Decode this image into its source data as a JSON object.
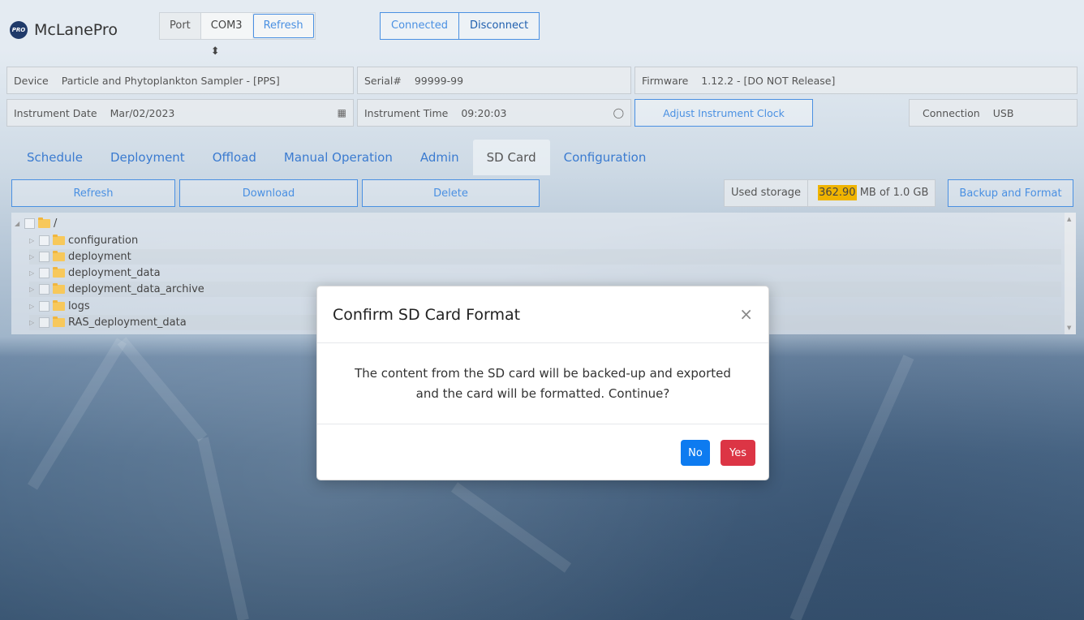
{
  "brand": {
    "logo": "PRO",
    "name": "McLanePro"
  },
  "port": {
    "label": "Port",
    "value": "COM3 ⬍",
    "refresh": "Refresh"
  },
  "connection_buttons": {
    "connected": "Connected",
    "disconnect": "Disconnect"
  },
  "device": {
    "device_label": "Device",
    "device_value": "Particle and Phytoplankton Sampler - [PPS]",
    "serial_label": "Serial#",
    "serial_value": "99999-99",
    "firmware_label": "Firmware",
    "firmware_value": "1.12.2 - [DO NOT Release]",
    "date_label": "Instrument Date",
    "date_value": "Mar/02/2023",
    "time_label": "Instrument Time",
    "time_value": "09:20:03",
    "adjust_clock": "Adjust Instrument Clock",
    "connection_label": "Connection",
    "connection_value": "USB"
  },
  "tabs": [
    {
      "label": "Schedule"
    },
    {
      "label": "Deployment"
    },
    {
      "label": "Offload"
    },
    {
      "label": "Manual Operation"
    },
    {
      "label": "Admin"
    },
    {
      "label": "SD Card"
    },
    {
      "label": "Configuration"
    }
  ],
  "actions": {
    "refresh": "Refresh",
    "download": "Download",
    "delete": "Delete",
    "backup_format": "Backup and Format"
  },
  "storage": {
    "label": "Used storage",
    "used": "362.90",
    "suffix": " MB of 1.0 GB",
    "highlight_color": "#f0b400"
  },
  "tree": {
    "root": "/",
    "items": [
      "configuration",
      "deployment",
      "deployment_data",
      "deployment_data_archive",
      "logs",
      "RAS_deployment_data"
    ]
  },
  "modal": {
    "title": "Confirm SD Card Format",
    "close": "×",
    "line1": "The content from the SD card will be backed-up and exported",
    "line2": "and the card will be formatted. Continue?",
    "no": "No",
    "yes": "Yes"
  },
  "colors": {
    "primary": "#4a90e2",
    "no_button": "#0d7bf0",
    "yes_button": "#dc3545"
  }
}
